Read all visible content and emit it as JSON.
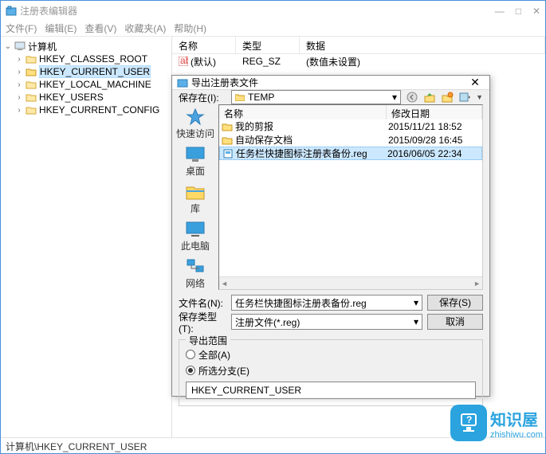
{
  "window": {
    "title": "注册表编辑器",
    "controls": {
      "min": "—",
      "max": "□",
      "close": "✕"
    }
  },
  "menu": {
    "file": "文件(F)",
    "edit": "编辑(E)",
    "view": "查看(V)",
    "fav": "收藏夹(A)",
    "help": "帮助(H)"
  },
  "tree": {
    "root": "计算机",
    "nodes": [
      "HKEY_CLASSES_ROOT",
      "HKEY_CURRENT_USER",
      "HKEY_LOCAL_MACHINE",
      "HKEY_USERS",
      "HKEY_CURRENT_CONFIG"
    ]
  },
  "list": {
    "headers": {
      "name": "名称",
      "type": "类型",
      "data": "数据"
    },
    "row": {
      "name": "(默认)",
      "type": "REG_SZ",
      "data": "(数值未设置)"
    }
  },
  "status": "计算机\\HKEY_CURRENT_USER",
  "dialog": {
    "title": "导出注册表文件",
    "close": "✕",
    "savein_label": "保存在(I):",
    "savein_value": "TEMP",
    "places": {
      "quick": "快速访问",
      "desktop": "桌面",
      "libs": "库",
      "pc": "此电脑",
      "net": "网络"
    },
    "filelist": {
      "headers": {
        "name": "名称",
        "date": "修改日期"
      },
      "rows": [
        {
          "name": "我的剪报",
          "date": "2015/11/21 18:52",
          "type": "folder"
        },
        {
          "name": "自动保存文档",
          "date": "2015/09/28 16:45",
          "type": "folder"
        },
        {
          "name": "任务栏快捷图标注册表备份.reg",
          "date": "2016/06/05 22:34",
          "type": "reg"
        }
      ]
    },
    "filename_label": "文件名(N):",
    "filename_value": "任务栏快捷图标注册表备份.reg",
    "filetype_label": "保存类型(T):",
    "filetype_value": "注册文件(*.reg)",
    "save_btn": "保存(S)",
    "cancel_btn": "取消",
    "scope": {
      "legend": "导出范围",
      "all": "全部(A)",
      "selected": "所选分支(E)",
      "branch": "HKEY_CURRENT_USER"
    }
  },
  "watermark": {
    "text": "知识屋",
    "sub": "zhishiwu.com"
  }
}
